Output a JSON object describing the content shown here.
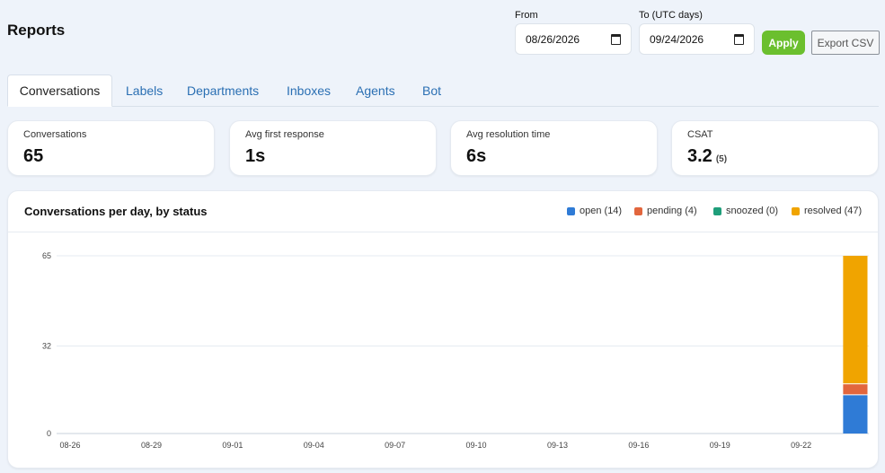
{
  "page": {
    "title": "Reports"
  },
  "filters": {
    "from_label": "From",
    "from_value": "08/26/2026",
    "to_label": "To (UTC days)",
    "to_value": "09/24/2026",
    "apply_label": "Apply",
    "export_label": "Export CSV"
  },
  "tabs": [
    {
      "label": "Conversations",
      "active": true
    },
    {
      "label": "Labels"
    },
    {
      "label": "Departments"
    },
    {
      "label": "Inboxes"
    },
    {
      "label": "Agents"
    },
    {
      "label": "Bot"
    }
  ],
  "stats": [
    {
      "label": "Conversations",
      "value": "65",
      "sub": ""
    },
    {
      "label": "Avg first response",
      "value": "1s",
      "sub": ""
    },
    {
      "label": "Avg resolution time",
      "value": "6s",
      "sub": ""
    },
    {
      "label": "CSAT",
      "value": "3.2",
      "sub": "(5)"
    }
  ],
  "chart": {
    "title": "Conversations per day, by status",
    "legend": [
      {
        "label": "open (14)",
        "color": "#2f7bd6"
      },
      {
        "label": "pending (4)",
        "color": "#e2663d"
      },
      {
        "label": "snoozed (0)",
        "color": "#1f9e7a"
      },
      {
        "label": "resolved (47)",
        "color": "#f0a400"
      }
    ]
  },
  "chart_data": {
    "type": "bar",
    "stacked": true,
    "title": "Conversations per day, by status",
    "xlabel": "",
    "ylabel": "",
    "ylim": [
      0,
      65
    ],
    "yticks": [
      "65",
      "32",
      "0"
    ],
    "x_tick_labels": [
      "08-26",
      "08-29",
      "09-01",
      "09-04",
      "09-07",
      "09-10",
      "09-13",
      "09-16",
      "09-19",
      "09-22"
    ],
    "categories": [
      "08-26",
      "08-27",
      "08-28",
      "08-29",
      "08-30",
      "08-31",
      "09-01",
      "09-02",
      "09-03",
      "09-04",
      "09-05",
      "09-06",
      "09-07",
      "09-08",
      "09-09",
      "09-10",
      "09-11",
      "09-12",
      "09-13",
      "09-14",
      "09-15",
      "09-16",
      "09-17",
      "09-18",
      "09-19",
      "09-20",
      "09-21",
      "09-22",
      "09-23",
      "09-24"
    ],
    "series": [
      {
        "name": "open",
        "color": "#2f7bd6",
        "values": [
          0,
          0,
          0,
          0,
          0,
          0,
          0,
          0,
          0,
          0,
          0,
          0,
          0,
          0,
          0,
          0,
          0,
          0,
          0,
          0,
          0,
          0,
          0,
          0,
          0,
          0,
          0,
          0,
          0,
          14
        ]
      },
      {
        "name": "pending",
        "color": "#e2663d",
        "values": [
          0,
          0,
          0,
          0,
          0,
          0,
          0,
          0,
          0,
          0,
          0,
          0,
          0,
          0,
          0,
          0,
          0,
          0,
          0,
          0,
          0,
          0,
          0,
          0,
          0,
          0,
          0,
          0,
          0,
          4
        ]
      },
      {
        "name": "snoozed",
        "color": "#1f9e7a",
        "values": [
          0,
          0,
          0,
          0,
          0,
          0,
          0,
          0,
          0,
          0,
          0,
          0,
          0,
          0,
          0,
          0,
          0,
          0,
          0,
          0,
          0,
          0,
          0,
          0,
          0,
          0,
          0,
          0,
          0,
          0
        ]
      },
      {
        "name": "resolved",
        "color": "#f0a400",
        "values": [
          0,
          0,
          0,
          0,
          0,
          0,
          0,
          0,
          0,
          0,
          0,
          0,
          0,
          0,
          0,
          0,
          0,
          0,
          0,
          0,
          0,
          0,
          0,
          0,
          0,
          0,
          0,
          0,
          0,
          47
        ]
      }
    ]
  }
}
